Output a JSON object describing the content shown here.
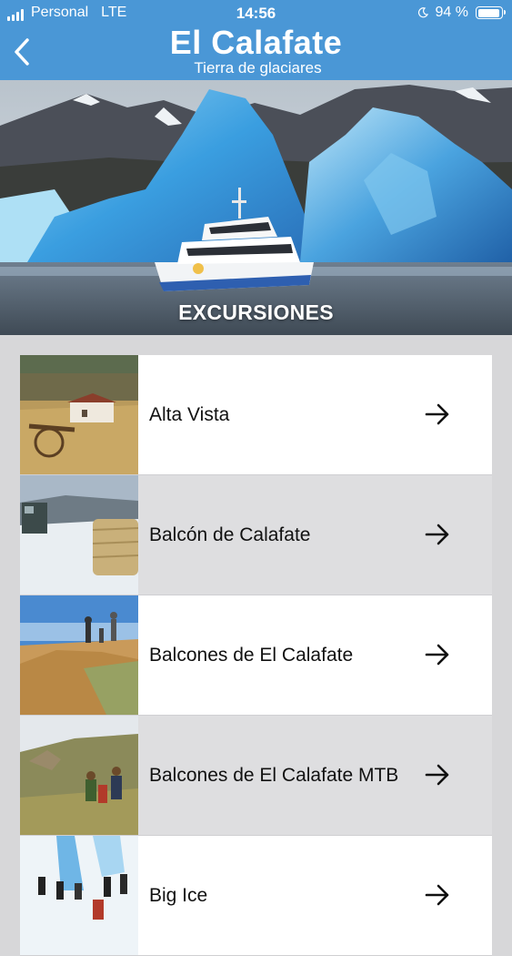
{
  "status_bar": {
    "carrier": "Personal",
    "network": "LTE",
    "time": "14:56",
    "battery": "94 %",
    "battery_level": 0.94,
    "moon_icon": "moon-icon"
  },
  "header": {
    "title": "El Calafate",
    "subtitle": "Tierra de glaciares",
    "back_icon": "chevron-left-icon",
    "color": "#4a97d6"
  },
  "hero": {
    "label": "EXCURSIONES"
  },
  "excursions": [
    {
      "label": "Alta Vista"
    },
    {
      "label": "Balcón de Calafate"
    },
    {
      "label": "Balcones de El Calafate"
    },
    {
      "label": "Balcones de El Calafate MTB"
    },
    {
      "label": "Big Ice"
    }
  ]
}
